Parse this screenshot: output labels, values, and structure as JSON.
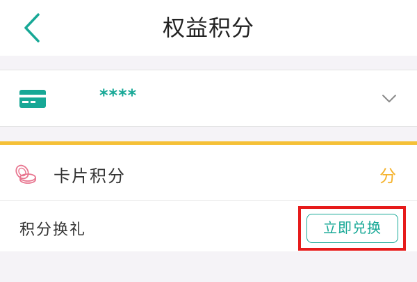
{
  "header": {
    "title": "权益积分"
  },
  "card": {
    "number_masked": "****"
  },
  "points": {
    "label": "卡片积分",
    "unit": "分"
  },
  "exchange": {
    "label": "积分换礼",
    "button_label": "立即兑换"
  },
  "colors": {
    "accent_teal": "#17a896",
    "accent_gold": "#f5c037",
    "highlight_red": "#e61b1b",
    "coin_pink": "#e8758f"
  },
  "icons": {
    "back": "chevron-left-icon",
    "card": "credit-card-icon",
    "expand": "chevron-down-icon",
    "points": "coins-icon"
  }
}
